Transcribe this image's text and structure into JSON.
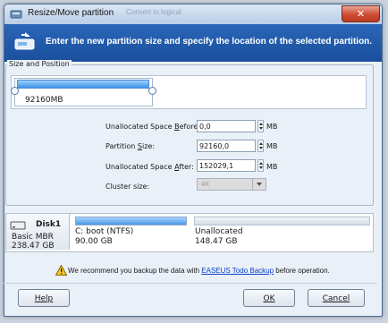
{
  "window": {
    "title": "Resize/Move partition",
    "background_tabs": [
      "Convert to logical"
    ],
    "close_glyph": "✕"
  },
  "banner": {
    "text": "Enter the new partition size and specify the location of the selected partition."
  },
  "size_position": {
    "group_label": "Size and Position",
    "partition_label": "92160MB",
    "fields": {
      "before": {
        "label_pre": "Unallocated Space ",
        "label_u": "B",
        "label_post": "efore:",
        "value": "0,0",
        "unit": "MB"
      },
      "size": {
        "label_pre": "Partition ",
        "label_u": "S",
        "label_post": "ize:",
        "value": "92160,0",
        "unit": "MB"
      },
      "after": {
        "label_pre": "Unallocated Space ",
        "label_u": "A",
        "label_post": "fter:",
        "value": "152029,1",
        "unit": "MB"
      },
      "cluster": {
        "label": "Cluster size:",
        "value": "4K"
      }
    }
  },
  "disk": {
    "name": "Disk1",
    "type": "Basic MBR",
    "size": "238.47 GB",
    "partitions": [
      {
        "label": "C: boot (NTFS)",
        "size": "90.00 GB",
        "used_fraction": 1.0
      },
      {
        "label": "Unallocated",
        "size": "148.47 GB",
        "used_fraction": 0.0
      }
    ]
  },
  "notice": {
    "pre": "We recommend you backup the data with ",
    "link": "EASEUS Todo Backup",
    "post": " before operation."
  },
  "buttons": {
    "help": "Help",
    "ok": "OK",
    "cancel": "Cancel"
  }
}
